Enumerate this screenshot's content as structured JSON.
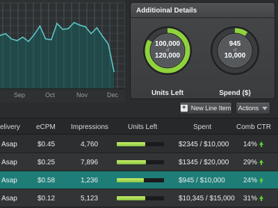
{
  "chart": {
    "months": [
      "Sep",
      "Oct",
      "Nov",
      "Dec"
    ],
    "chart_data": {
      "type": "area",
      "x": [
        0,
        1,
        2,
        3,
        4,
        5,
        6,
        7,
        8,
        9,
        10,
        11,
        12,
        13,
        14,
        15,
        16,
        17,
        18,
        19,
        20
      ],
      "values": [
        62,
        64,
        58,
        56,
        60,
        55,
        63,
        73,
        58,
        57,
        76,
        69,
        70,
        77,
        74,
        72,
        64,
        71,
        61,
        52,
        20
      ],
      "ylim": [
        0,
        100
      ],
      "grid": true,
      "colors": {
        "line": "#5ec8c8",
        "fill": "#1f4e4d",
        "grid": "#3a4448"
      }
    }
  },
  "details": {
    "title": "Additioinal Details",
    "gauges": [
      {
        "value": "100,000",
        "of": "of",
        "total": "120,000",
        "label": "Units Left",
        "fraction": 0.83,
        "color": "#8ed23c"
      },
      {
        "value": "945",
        "of": "of",
        "total": "10,000",
        "label": "Spend ($)",
        "fraction": 0.095,
        "color": "#8ed23c"
      }
    ]
  },
  "buttons": {
    "new_line_item": "New Line Item",
    "actions": "Actions",
    "new_icon": "plus-icon",
    "actions_icon": "caret-down-icon"
  },
  "table": {
    "headers": [
      "elivery",
      "eCPM",
      "Impressions",
      "Units Left",
      "Spent",
      "Comb CTR"
    ],
    "rows": [
      {
        "delivery": "Asap",
        "ecpm": "$0.45",
        "impressions": "4,760",
        "units_left_fraction": 0.6,
        "spent": "$2345 / $10,000",
        "ctr": "14%",
        "selected": false
      },
      {
        "delivery": "Asap",
        "ecpm": "$0.25",
        "impressions": "7,896",
        "units_left_fraction": 0.62,
        "spent": "$1345 / $20,000",
        "ctr": "29%",
        "selected": false
      },
      {
        "delivery": "Asap",
        "ecpm": "$0.58",
        "impressions": "1,236",
        "units_left_fraction": 0.58,
        "spent": "$945 / $10,000",
        "ctr": "24%",
        "selected": true
      },
      {
        "delivery": "Asap",
        "ecpm": "$0.12",
        "impressions": "5,123",
        "units_left_fraction": 0.6,
        "spent": "$10,345 / $15,000",
        "ctr": "31%",
        "selected": false
      }
    ],
    "trend_icon": "up-arrow-icon",
    "trend_color": "#5bd12f"
  }
}
